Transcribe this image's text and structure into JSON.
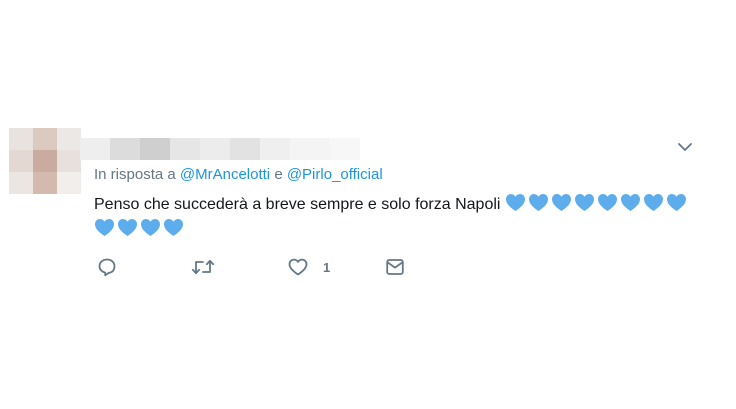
{
  "tweet": {
    "reply_prefix": "In risposta a",
    "reply_to_1": "@MrAncelotti",
    "reply_conjunction": "e",
    "reply_to_2": "@Pirlo_official",
    "text": "Penso che succederà a breve sempre e solo forza Napoli",
    "emoji_name": "blue-heart",
    "emoji_count": 12,
    "like_count": "1"
  },
  "actions": {
    "icons": [
      "reply-icon",
      "retweet-icon",
      "like-icon",
      "message-icon"
    ]
  },
  "colors": {
    "text": "#14171a",
    "secondary": "#657786",
    "link": "#1b95e0",
    "heart": "#5dadec"
  }
}
